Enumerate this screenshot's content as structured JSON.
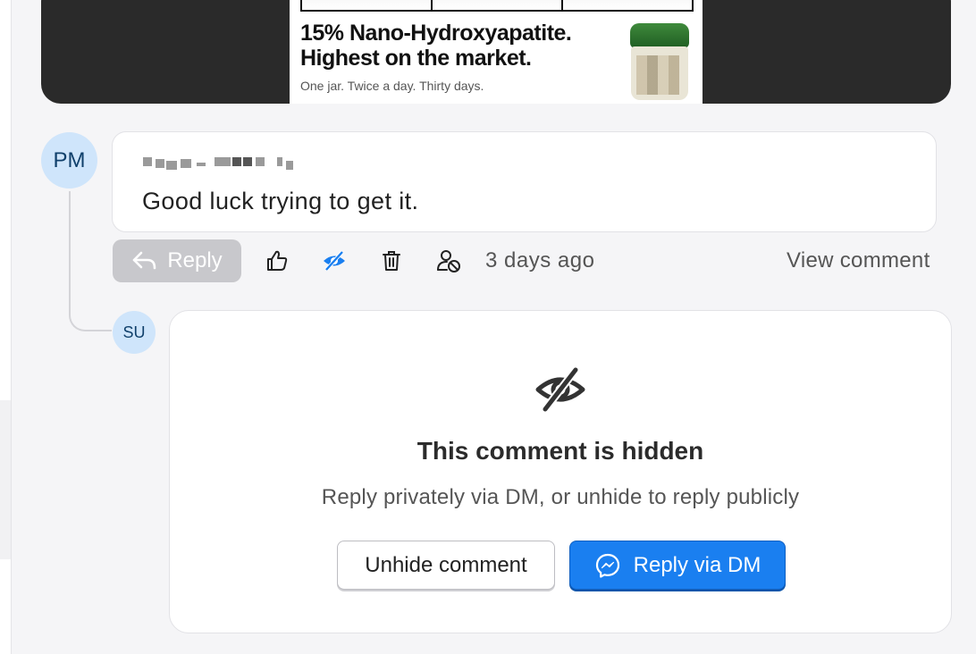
{
  "media": {
    "ad_headline": "15% Nano-Hydroxyapatite. Highest on the market.",
    "ad_tagline": "One jar. Twice a day. Thirty days."
  },
  "comment": {
    "avatar_initials": "PM",
    "text": "Good luck trying to get it.",
    "reply_label": "Reply",
    "timestamp": "3 days ago",
    "view_label": "View comment",
    "icons": [
      "reply-arrow-icon",
      "thumbs-up-icon",
      "eye-off-icon",
      "trash-icon",
      "block-user-icon"
    ]
  },
  "hidden_reply": {
    "avatar_initials": "SU",
    "title": "This comment is hidden",
    "subtitle": "Reply privately via DM, or unhide to reply publicly",
    "unhide_label": "Unhide comment",
    "dm_label": "Reply via DM",
    "icons": [
      "eye-off-icon",
      "messenger-icon"
    ]
  },
  "colors": {
    "accent": "#1a7ff0",
    "active_icon": "#1a7ff0",
    "avatar_bg": "#cfe5fb",
    "avatar_text": "#10406b",
    "reply_disabled": "#c8c8cc"
  }
}
